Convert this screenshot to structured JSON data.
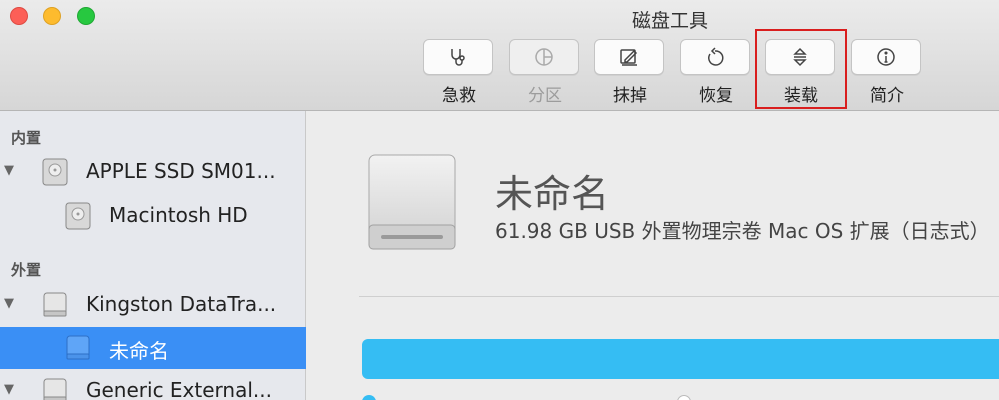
{
  "window": {
    "title": "磁盘工具"
  },
  "toolbar": {
    "items": [
      {
        "label": "急救",
        "icon": "stethoscope-icon",
        "enabled": true
      },
      {
        "label": "分区",
        "icon": "partition-icon",
        "enabled": false
      },
      {
        "label": "抹掉",
        "icon": "erase-icon",
        "enabled": true
      },
      {
        "label": "恢复",
        "icon": "restore-icon",
        "enabled": true
      },
      {
        "label": "装载",
        "icon": "mount-icon",
        "enabled": true,
        "highlighted": true
      },
      {
        "label": "简介",
        "icon": "info-icon",
        "enabled": true
      }
    ],
    "highlight_color": "#d91e1e"
  },
  "sidebar": {
    "internal_header": "内置",
    "external_header": "外置",
    "items": [
      {
        "label": "APPLE SSD SM01...",
        "level": 0,
        "expanded": true,
        "icon": "internal-disk-icon"
      },
      {
        "label": "Macintosh HD",
        "level": 1,
        "icon": "volume-icon"
      },
      {
        "label": "Kingston DataTra...",
        "level": 0,
        "expanded": true,
        "icon": "external-disk-icon"
      },
      {
        "label": "未命名",
        "level": 1,
        "selected": true,
        "icon": "volume-icon"
      },
      {
        "label": "Generic External...",
        "level": 0,
        "expanded": true,
        "icon": "external-disk-icon"
      }
    ],
    "selected_color": "#3a8ff5"
  },
  "main": {
    "volume_name": "未命名",
    "volume_description": "61.98 GB USB 外置物理宗卷 Mac OS 扩展（日志式）",
    "usage_color": "#35bdf3"
  }
}
